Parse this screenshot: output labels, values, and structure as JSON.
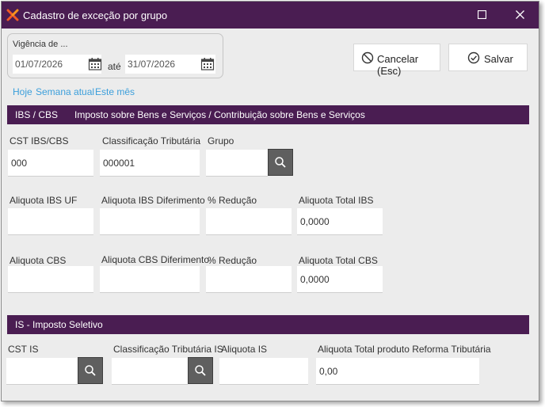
{
  "window": {
    "title": "Cadastro de exceção por grupo",
    "accent_color": "#4a1d52",
    "logo_icon": "orange-x-logo-icon",
    "maximize_icon": "maximize-icon",
    "close_icon": "close-icon"
  },
  "vigencia": {
    "label": "Vigência de ...",
    "from": "01/07/2026",
    "separator": "até",
    "to": "31/07/2026",
    "calendar_icon": "calendar-icon"
  },
  "actions": {
    "cancel_label": "Cancelar (Esc)",
    "cancel_icon": "cancel-circle-icon",
    "save_label": "Salvar",
    "save_icon": "check-circle-icon"
  },
  "quick_links": [
    "Hoje",
    "Semana atual",
    "Este mês"
  ],
  "link_color": "#3c9fdb",
  "ibs_cbs": {
    "code": "IBS / CBS",
    "title": "Imposto sobre Bens e Serviços / Contribuição sobre Bens e Serviços",
    "cst_label": "CST IBS/CBS",
    "cst_value": "000",
    "classificacao_label": "Classificação Tributária",
    "classificacao_value": "000001",
    "grupo_label": "Grupo",
    "grupo_value": "",
    "aliq_ibs_uf_label": "Aliquota IBS UF",
    "aliq_ibs_uf_value": "",
    "aliq_ibs_dif_label": "Aliquota IBS Diferimento",
    "aliq_ibs_dif_value": "",
    "reducao_ibs_label": "% Redução",
    "reducao_ibs_value": "",
    "total_ibs_label": "Aliquota Total IBS",
    "total_ibs_value": "0,0000",
    "aliq_cbs_label": "Aliquota CBS",
    "aliq_cbs_value": "",
    "aliq_cbs_dif_label": "Aliquota CBS Diferimento",
    "aliq_cbs_dif_value": "",
    "reducao_cbs_label": "% Redução",
    "reducao_cbs_value": "",
    "total_cbs_label": "Aliquota Total CBS",
    "total_cbs_value": "0,0000"
  },
  "is": {
    "title": "IS - Imposto Seletivo",
    "cst_label": "CST IS",
    "cst_value": "",
    "classificacao_label": "Classificação Tributária IS",
    "classificacao_value": "",
    "aliquota_label": "Aliquota IS",
    "aliquota_value": "",
    "total_label": "Aliquota Total produto Reforma Tributária",
    "total_value": "0,00"
  }
}
